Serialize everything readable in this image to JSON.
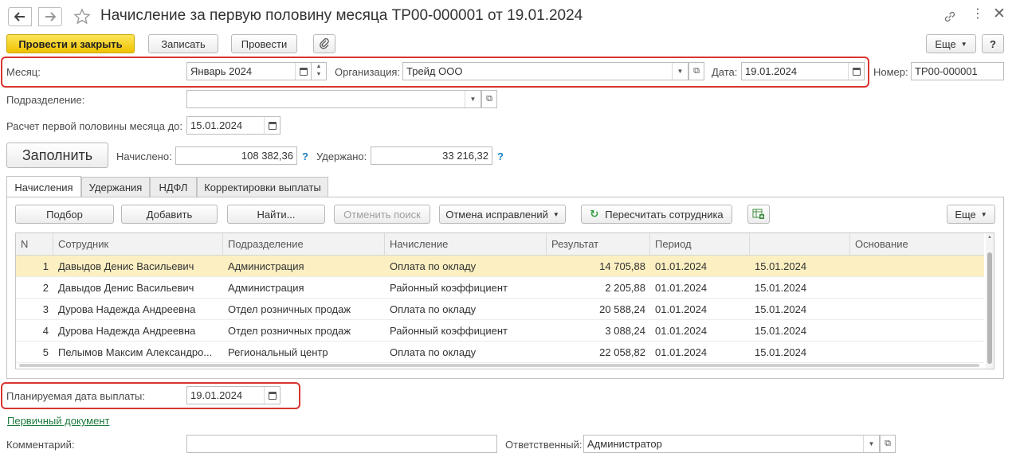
{
  "title": "Начисление за первую половину месяца ТР00-000001 от 19.01.2024",
  "toolbar": {
    "post_close": "Провести и закрыть",
    "save": "Записать",
    "post": "Провести",
    "more": "Еще",
    "help": "?"
  },
  "header": {
    "month_label": "Месяц:",
    "month_value": "Январь 2024",
    "org_label": "Организация:",
    "org_value": "Трейд ООО",
    "date_label": "Дата:",
    "date_value": "19.01.2024",
    "number_label": "Номер:",
    "number_value": "ТР00-000001",
    "division_label": "Подразделение:",
    "division_value": "",
    "calc_until_label": "Расчет первой половины месяца до:",
    "calc_until_value": "15.01.2024"
  },
  "totals": {
    "fill_button": "Заполнить",
    "accrued_label": "Начислено:",
    "accrued_value": "108 382,36",
    "withheld_label": "Удержано:",
    "withheld_value": "33 216,32"
  },
  "tabs": [
    "Начисления",
    "Удержания",
    "НДФЛ",
    "Корректировки выплаты"
  ],
  "table_toolbar": {
    "select": "Подбор",
    "add": "Добавить",
    "find": "Найти...",
    "cancel_search": "Отменить поиск",
    "cancel_fixes": "Отмена исправлений",
    "recalc": "Пересчитать сотрудника",
    "more": "Еще"
  },
  "table": {
    "columns": [
      "N",
      "Сотрудник",
      "Подразделение",
      "Начисление",
      "Результат",
      "Период",
      "",
      "Основание"
    ],
    "rows": [
      {
        "n": "1",
        "employee": "Давыдов Денис Васильевич",
        "division": "Администрация",
        "accrual": "Оплата по окладу",
        "result": "14 705,88",
        "from": "01.01.2024",
        "to": "15.01.2024",
        "basis": ""
      },
      {
        "n": "2",
        "employee": "Давыдов Денис Васильевич",
        "division": "Администрация",
        "accrual": "Районный коэффициент",
        "result": "2 205,88",
        "from": "01.01.2024",
        "to": "15.01.2024",
        "basis": ""
      },
      {
        "n": "3",
        "employee": "Дурова Надежда Андреевна",
        "division": "Отдел розничных продаж",
        "accrual": "Оплата по окладу",
        "result": "20 588,24",
        "from": "01.01.2024",
        "to": "15.01.2024",
        "basis": ""
      },
      {
        "n": "4",
        "employee": "Дурова Надежда Андреевна",
        "division": "Отдел розничных продаж",
        "accrual": "Районный коэффициент",
        "result": "3 088,24",
        "from": "01.01.2024",
        "to": "15.01.2024",
        "basis": ""
      },
      {
        "n": "5",
        "employee": "Пелымов Максим Александро...",
        "division": "Региональный центр",
        "accrual": "Оплата по окладу",
        "result": "22 058,82",
        "from": "01.01.2024",
        "to": "15.01.2024",
        "basis": ""
      }
    ]
  },
  "footer": {
    "pay_date_label": "Планируемая дата выплаты:",
    "pay_date_value": "19.01.2024",
    "primary_doc_link": "Первичный документ",
    "comment_label": "Комментарий:",
    "comment_value": "",
    "responsible_label": "Ответственный:",
    "responsible_value": "Администратор"
  },
  "colors": {
    "accent_yellow": "#f5d21e",
    "highlight_red": "#d9352f",
    "selected_row": "#fcefc2",
    "link_green": "#1d7a3e"
  }
}
